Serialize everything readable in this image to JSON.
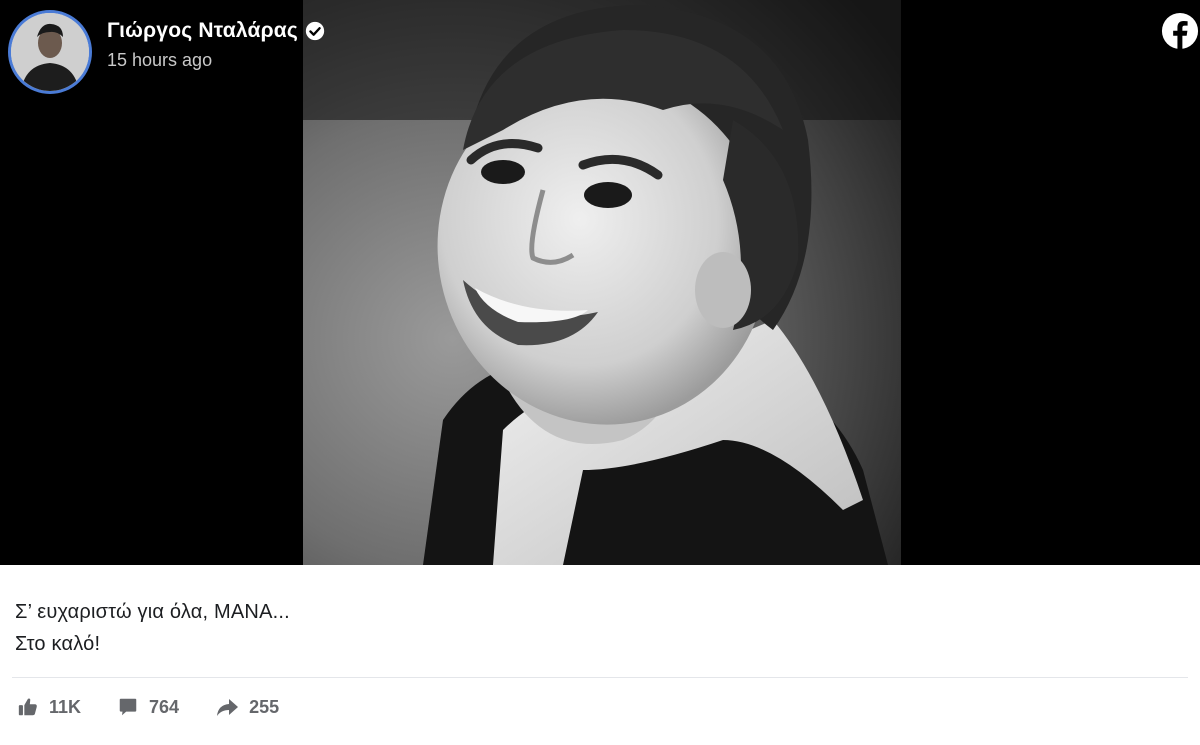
{
  "post": {
    "author": "Γιώργος Νταλάρας",
    "timestamp": "15 hours ago",
    "caption_line1": "Σ’ ευχαριστώ για όλα, ΜΑΝΑ...",
    "caption_line2": "Στο καλό!"
  },
  "stats": {
    "likes": "11K",
    "comments": "764",
    "shares": "255"
  },
  "icons": {
    "verified": "verified-badge-icon",
    "platform": "facebook-logo-icon",
    "like": "thumbs-up-icon",
    "comment": "comment-bubble-icon",
    "share": "share-arrow-icon"
  },
  "colors": {
    "avatar_ring": "#4a7bd6",
    "media_background": "#000000",
    "text_primary": "#1c1e21",
    "text_secondary": "#65676b"
  }
}
